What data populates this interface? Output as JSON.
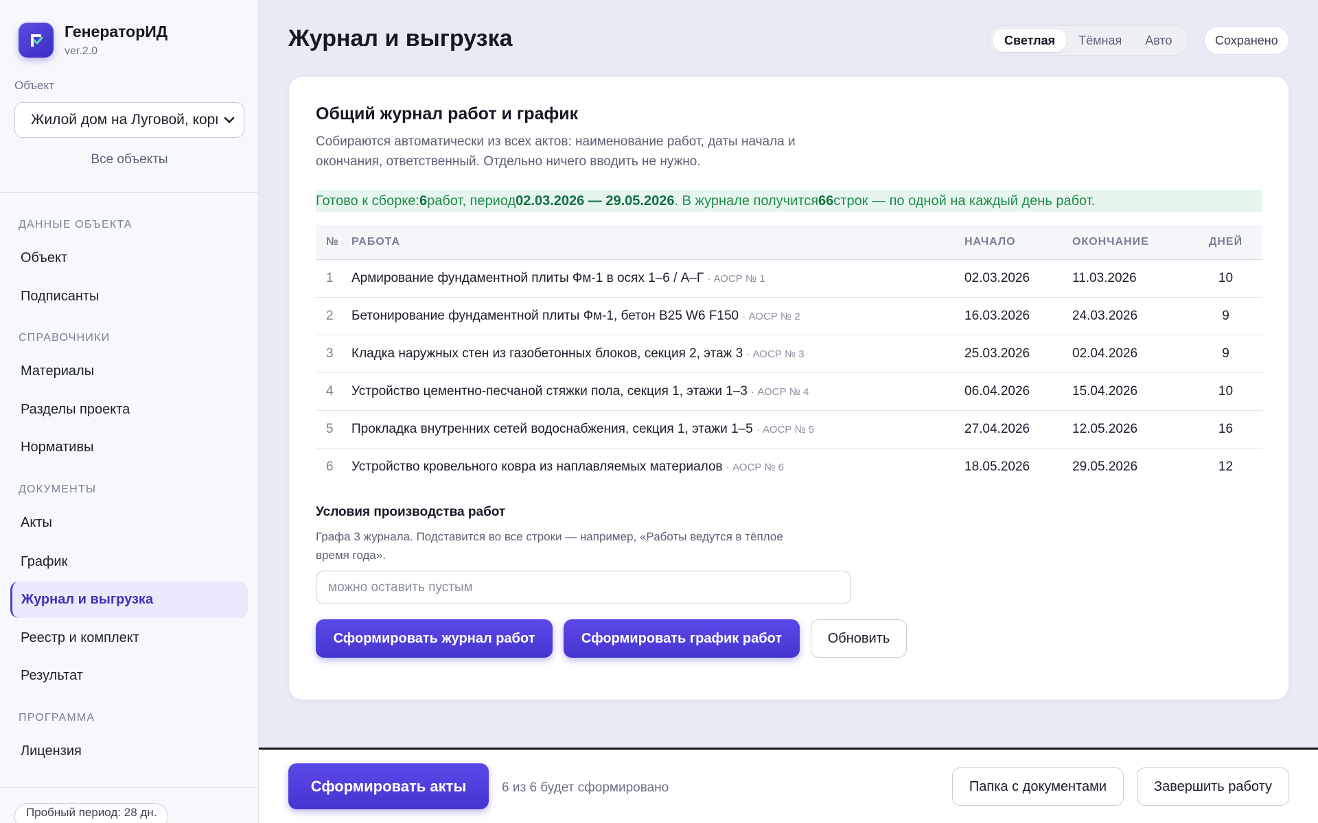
{
  "app": {
    "name": "ГенераторИД",
    "version": "ver.2.0"
  },
  "sidebar": {
    "object_label": "Объект",
    "object_value": "Жилой дом на Луговой, корп",
    "all_objects": "Все объекты",
    "sections": [
      {
        "title": "Данные объекта",
        "items": [
          {
            "label": "Объект"
          },
          {
            "label": "Подписанты"
          }
        ]
      },
      {
        "title": "Справочники",
        "items": [
          {
            "label": "Материалы"
          },
          {
            "label": "Разделы проекта"
          },
          {
            "label": "Нормативы"
          }
        ]
      },
      {
        "title": "Документы",
        "items": [
          {
            "label": "Акты"
          },
          {
            "label": "График"
          },
          {
            "label": "Журнал и выгрузка",
            "active": true
          },
          {
            "label": "Реестр и комплект"
          },
          {
            "label": "Результат"
          }
        ]
      },
      {
        "title": "Программа",
        "items": [
          {
            "label": "Лицензия"
          }
        ]
      }
    ],
    "trial": "Пробный период: 28 дн."
  },
  "header": {
    "title": "Журнал и выгрузка",
    "theme_options": [
      {
        "label": "Светлая",
        "selected": true
      },
      {
        "label": "Тёмная"
      },
      {
        "label": "Авто"
      }
    ],
    "saved": "Сохранено"
  },
  "card": {
    "title": "Общий журнал работ и график",
    "description": "Собираются автоматически из всех актов: наименование работ, даты начала и окончания, ответственный. Отдельно ничего вводить не нужно.",
    "ready": {
      "p1": "Готово к сборке: ",
      "works_count": "6",
      "p2": " работ, период ",
      "period": "02.03.2026 — 29.05.2026",
      "p3": ". В журнале получится ",
      "rows_count": "66",
      "p4": " строк — по одной на каждый день работ."
    },
    "table": {
      "headers": {
        "no": "№",
        "work": "Работа",
        "start": "Начало",
        "end": "Окончание",
        "days": "Дней"
      },
      "rows": [
        {
          "no": "1",
          "work": "Армирование фундаментной плиты Фм-1 в осях 1–6 / А–Г",
          "ref": "· АОСР № 1",
          "start": "02.03.2026",
          "end": "11.03.2026",
          "days": "10"
        },
        {
          "no": "2",
          "work": "Бетонирование фундаментной плиты Фм-1, бетон В25 W6 F150",
          "ref": "· АОСР № 2",
          "start": "16.03.2026",
          "end": "24.03.2026",
          "days": "9"
        },
        {
          "no": "3",
          "work": "Кладка наружных стен из газобетонных блоков, секция 2, этаж 3",
          "ref": "· АОСР № 3",
          "start": "25.03.2026",
          "end": "02.04.2026",
          "days": "9"
        },
        {
          "no": "4",
          "work": "Устройство цементно-песчаной стяжки пола, секция 1, этажи 1–3",
          "ref": "· АОСР № 4",
          "start": "06.04.2026",
          "end": "15.04.2026",
          "days": "10"
        },
        {
          "no": "5",
          "work": "Прокладка внутренних сетей водоснабжения, секция 1, этажи 1–5",
          "ref": "· АОСР № 5",
          "start": "27.04.2026",
          "end": "12.05.2026",
          "days": "16"
        },
        {
          "no": "6",
          "work": "Устройство кровельного ковра из наплавляемых материалов",
          "ref": "· АОСР № 6",
          "start": "18.05.2026",
          "end": "29.05.2026",
          "days": "12"
        }
      ]
    },
    "conditions": {
      "title": "Условия производства работ",
      "description": "Графа 3 журнала. Подставится во все строки — например, «Работы ведутся в тёплое время года».",
      "value": "",
      "placeholder": "можно оставить пустым"
    },
    "buttons": {
      "journal": "Сформировать журнал работ",
      "schedule": "Сформировать график работ",
      "refresh": "Обновить"
    }
  },
  "bottom": {
    "generate": "Сформировать акты",
    "hint": "6 из 6 будет сформировано",
    "folder": "Папка с документами",
    "finish": "Завершить работу"
  },
  "colors": {
    "accent": "#4b3ed0",
    "success_bg": "#e7f6ec",
    "success_text": "#1f8a4f"
  },
  "icons": {
    "logo": "check-document-icon",
    "select": "chevron-down-icon"
  }
}
